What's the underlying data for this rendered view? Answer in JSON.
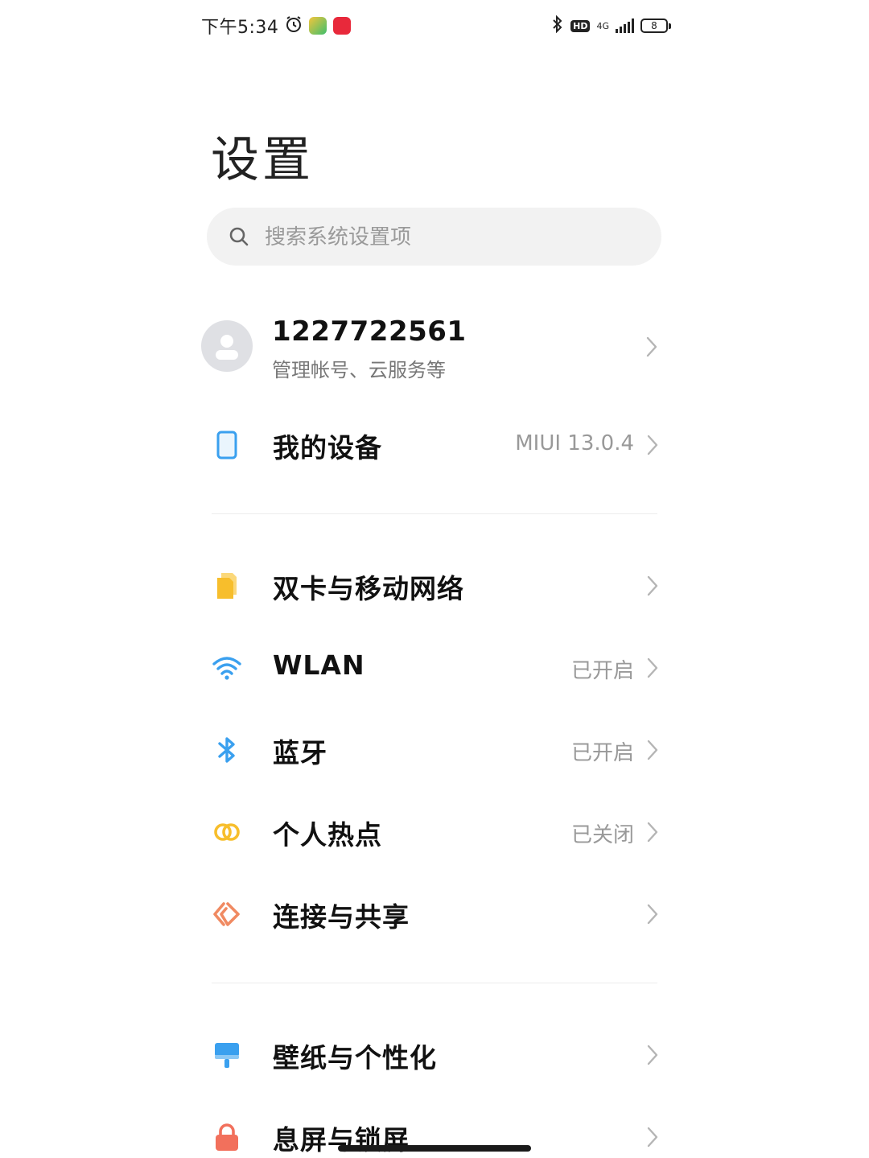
{
  "status_bar": {
    "time": "下午5:34",
    "network": "4G",
    "hd_label": "HD",
    "battery": "8"
  },
  "page": {
    "title": "设置"
  },
  "search": {
    "placeholder": "搜索系统设置项"
  },
  "account": {
    "name": "1227722561",
    "subtitle": "管理帐号、云服务等"
  },
  "sections": {
    "device": {
      "label": "我的设备",
      "value": "MIUI 13.0.4",
      "icon": "phone-icon"
    },
    "network": [
      {
        "label": "双卡与移动网络",
        "value": "",
        "icon": "sim-card-icon"
      },
      {
        "label": "WLAN",
        "value": "已开启",
        "icon": "wifi-icon"
      },
      {
        "label": "蓝牙",
        "value": "已开启",
        "icon": "bluetooth-icon"
      },
      {
        "label": "个人热点",
        "value": "已关闭",
        "icon": "hotspot-icon"
      },
      {
        "label": "连接与共享",
        "value": "",
        "icon": "connection-share-icon"
      }
    ],
    "personal": [
      {
        "label": "壁纸与个性化",
        "value": "",
        "icon": "wallpaper-icon"
      },
      {
        "label": "息屏与锁屏",
        "value": "",
        "icon": "lock-icon"
      }
    ]
  },
  "colors": {
    "blue": "#3aa0ef",
    "yellow": "#f7be2c",
    "orange": "#f08a62",
    "lock_red": "#f2705c"
  }
}
